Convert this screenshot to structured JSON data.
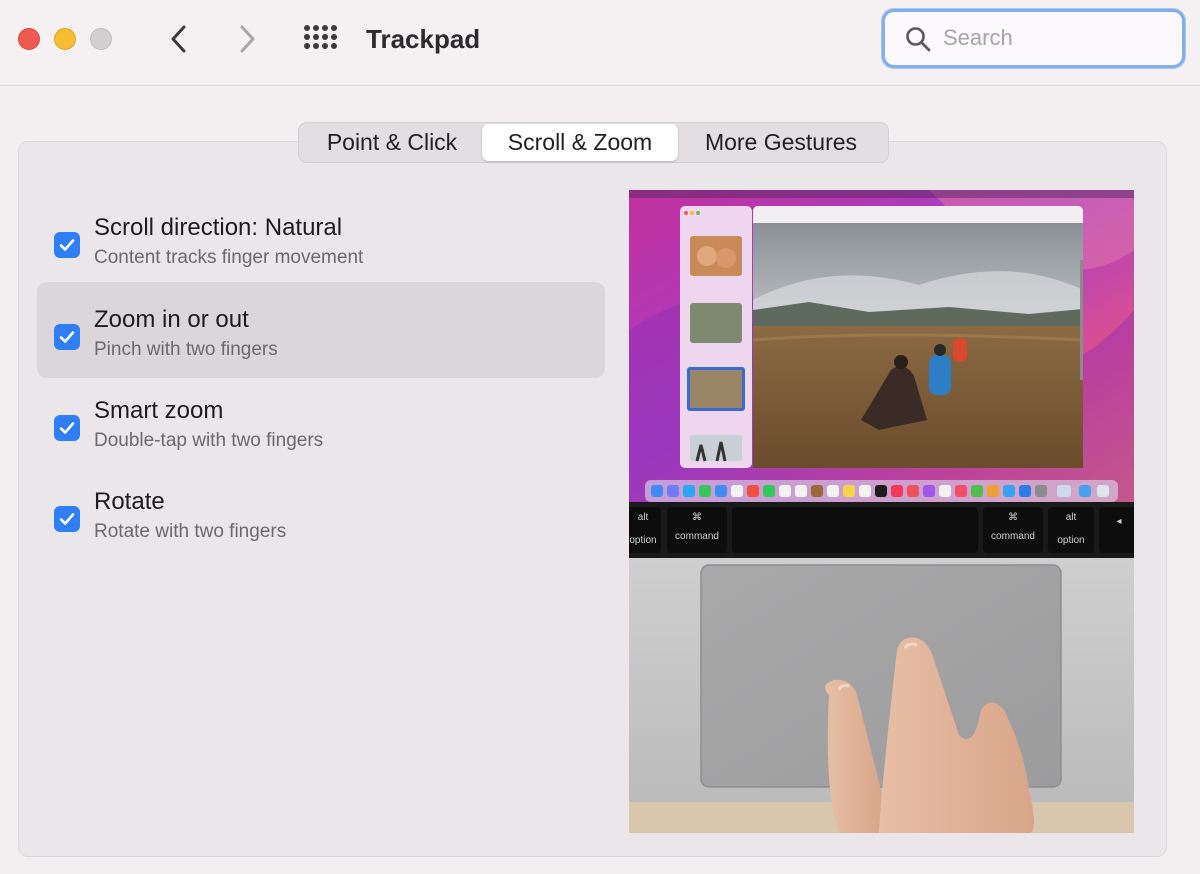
{
  "window": {
    "title": "Trackpad"
  },
  "titlebar": {
    "traffic_lights": [
      "close",
      "minimize",
      "zoom"
    ],
    "back_icon": "chevron-left-icon",
    "forward_icon": "chevron-right-icon",
    "show_all_icon": "grid-icon"
  },
  "search": {
    "placeholder": "Search",
    "icon": "search-icon"
  },
  "tabs": [
    {
      "label": "Point & Click",
      "selected": false
    },
    {
      "label": "Scroll & Zoom",
      "selected": true
    },
    {
      "label": "More Gestures",
      "selected": false
    }
  ],
  "options": [
    {
      "label": "Scroll direction: Natural",
      "description": "Content tracks finger movement",
      "checked": true,
      "selected": false
    },
    {
      "label": "Zoom in or out",
      "description": "Pinch with two fingers",
      "checked": true,
      "selected": true
    },
    {
      "label": "Smart zoom",
      "description": "Double-tap with two fingers",
      "checked": true,
      "selected": false
    },
    {
      "label": "Rotate",
      "description": "Rotate with two fingers",
      "checked": true,
      "selected": false
    }
  ],
  "preview": {
    "keys": [
      {
        "top": "alt",
        "bottom": "option"
      },
      {
        "top": "⌘",
        "bottom": "command"
      },
      {
        "top": "⌘",
        "bottom": "command"
      },
      {
        "top": "alt",
        "bottom": "option"
      },
      {
        "top": "",
        "bottom": "◂"
      }
    ]
  },
  "colors": {
    "accent": "#2f7ef6",
    "close": "#ee5a52",
    "minimize": "#f5bd31",
    "zoom_disabled": "#d3cfd1",
    "search_focus_ring": "#82aef0"
  }
}
